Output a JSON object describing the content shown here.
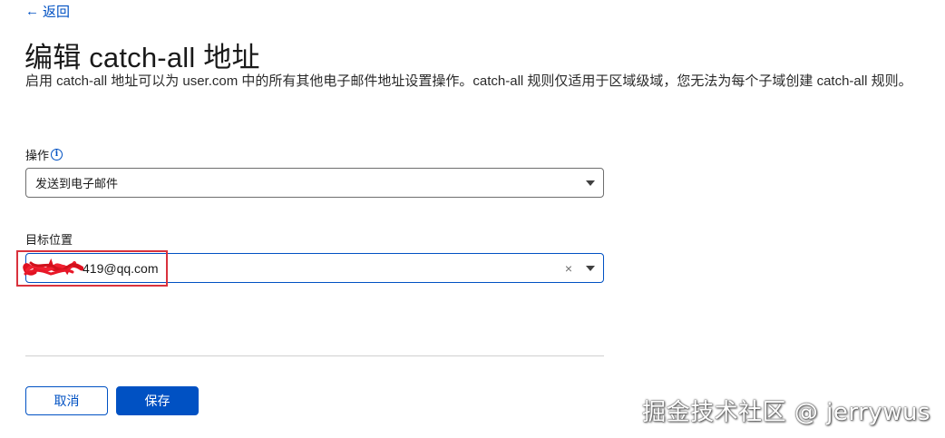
{
  "back": {
    "label": "返回"
  },
  "page": {
    "title": "编辑 catch-all 地址",
    "description": "启用 catch-all 地址可以为 user.com 中的所有其他电子邮件地址设置操作。catch-all 规则仅适用于区域级域，您无法为每个子域创建 catch-all 规则。"
  },
  "form": {
    "action": {
      "label": "操作",
      "value": "发送到电子邮件"
    },
    "destination": {
      "label": "目标位置",
      "value": "419@qq.com"
    }
  },
  "buttons": {
    "cancel": "取消",
    "save": "保存"
  },
  "watermark": "掘金技术社区 @ jerrywus",
  "colors": {
    "link": "#0051c3",
    "primary": "#0051c3",
    "annotation": "#d9323d"
  },
  "icons": {
    "back": "left-arrow-icon",
    "info": "info-icon",
    "dropdown": "caret-down-icon",
    "clear": "clear-x-icon"
  }
}
